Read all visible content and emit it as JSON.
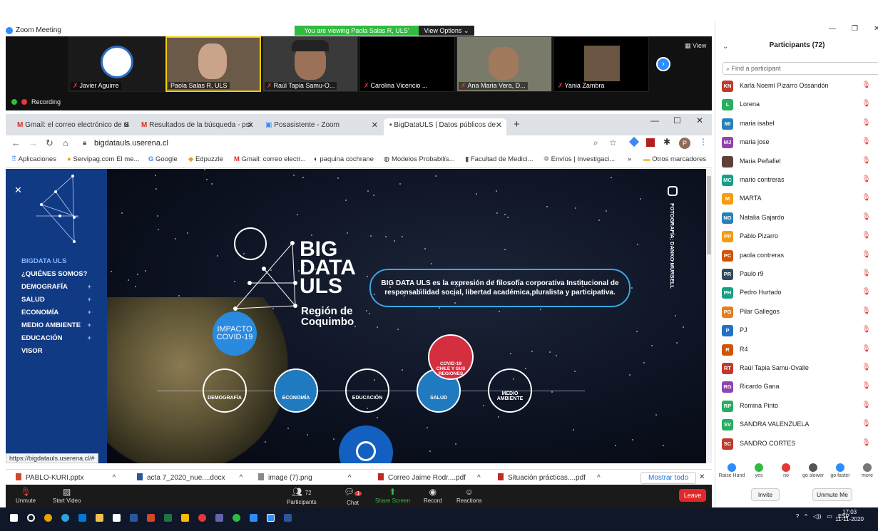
{
  "zoom": {
    "window_title": "Zoom Meeting",
    "viewing_banner": "You are viewing Paola Salas R, ULS' screen",
    "view_options": "View Options ⌄",
    "view_label": "View",
    "recording": "Recording",
    "tiles": [
      {
        "name": "Javier Aguirre"
      },
      {
        "name": "Paola Salas R, ULS"
      },
      {
        "name": "Raúl Tapia Samu-O..."
      },
      {
        "name": "Carolina Vicencio ..."
      },
      {
        "name": "Ana Maria Vera, D..."
      },
      {
        "name": "Yania Zambra"
      }
    ]
  },
  "browser": {
    "tabs": [
      {
        "label": "Gmail: el correo electrónico de G"
      },
      {
        "label": "Resultados de la búsqueda - psi"
      },
      {
        "label": "Posasistente - Zoom"
      },
      {
        "label": "BigDataULS | Datos públicos de"
      }
    ],
    "url": "bigdatauls.userena.cl",
    "bookmarks": [
      "Aplicaciones",
      "Servipag.com El me...",
      "Google",
      "Edpuzzle",
      "Gmail: correo electr...",
      "paquina cochrane",
      "Modelos Probabilís...",
      "Facultad de Medici...",
      "Envíos | Investigaci...",
      "»",
      "Otros marcadores"
    ],
    "status_url": "https://bigdatauls.userena.cl/#",
    "downloads": [
      "PABLO-KURI.pptx",
      "acta 7_2020_nue....docx",
      "image (7).png",
      "Correo Jaime Rodr....pdf",
      "Situación prácticas....pdf"
    ],
    "show_all": "Mostrar todo"
  },
  "site": {
    "menu": [
      {
        "label": "BIGDATA ULS",
        "plus": ""
      },
      {
        "label": "¿QUIÉNES SOMOS?",
        "plus": ""
      },
      {
        "label": "DEMOGRAFÍA",
        "plus": "+"
      },
      {
        "label": "SALUD",
        "plus": "+"
      },
      {
        "label": "ECONOMÍA",
        "plus": "+"
      },
      {
        "label": "MEDIO AMBIENTE",
        "plus": "+"
      },
      {
        "label": "EDUCACIÓN",
        "plus": "+"
      },
      {
        "label": "VISOR",
        "plus": ""
      }
    ],
    "big_line1": "BIG",
    "big_line2": "DATA",
    "big_line3": "ULS",
    "region1": "Región de",
    "region2": "Coquimbo",
    "description": "BIG DATA ULS es la expresión de filosofía corporativa Institucional de responsabilidad social, libertad académica,pluralista y participativa.",
    "impacto1": "IMPACTO",
    "impacto2": "COVID-19",
    "covid_badge1": "COVID-19",
    "covid_badge2": "CHILE Y SUS",
    "covid_badge3": "REGIONES",
    "circles": [
      "DEMOGRAFÍA",
      "ECONOMÍA",
      "EDUCACIÓN",
      "SALUD",
      "MEDIO AMBIENTE"
    ],
    "photo_credit": "FOTOGRAFÍA: DANKO MURSELL"
  },
  "toolbar": {
    "unmute": "Unmute",
    "start_video": "Start Video",
    "participants_count": "72",
    "participants": "Participants",
    "chat": "Chat",
    "chat_badge": "1",
    "share_screen": "Share Screen",
    "record": "Record",
    "reactions": "Reactions",
    "leave": "Leave"
  },
  "panel": {
    "title": "Participants (72)",
    "find_placeholder": "Find a participant",
    "participants": [
      {
        "initials": "KN",
        "name": "Karla Noemí Pizarro Ossandón",
        "color": "#c0392b"
      },
      {
        "initials": "L",
        "name": "Lorena",
        "color": "#27ae60"
      },
      {
        "initials": "MI",
        "name": "maria isabel",
        "color": "#2980b9"
      },
      {
        "initials": "MJ",
        "name": "maria jose",
        "color": "#8e44ad"
      },
      {
        "initials": "",
        "name": "Maria Peñafiel",
        "color": "#5d4037"
      },
      {
        "initials": "MC",
        "name": "mario contreras",
        "color": "#16a085"
      },
      {
        "initials": "M",
        "name": "MARTA",
        "color": "#f39c12"
      },
      {
        "initials": "NG",
        "name": "Natalia Gajardo",
        "color": "#2980b9"
      },
      {
        "initials": "PP",
        "name": "Pablo Pizarro",
        "color": "#f39c12"
      },
      {
        "initials": "PC",
        "name": "paola contreras",
        "color": "#d35400"
      },
      {
        "initials": "PR",
        "name": "Paulo r9",
        "color": "#34495e"
      },
      {
        "initials": "PH",
        "name": "Pedro Hurtado",
        "color": "#16a085"
      },
      {
        "initials": "PG",
        "name": "Pilar Gallegos",
        "color": "#e67e22"
      },
      {
        "initials": "P",
        "name": "PJ",
        "color": "#2471c8"
      },
      {
        "initials": "R",
        "name": "R4",
        "color": "#d35400"
      },
      {
        "initials": "RT",
        "name": "Raúl Tapia Samu-Ovalle",
        "color": "#c0392b"
      },
      {
        "initials": "RG",
        "name": "Ricardo Gana",
        "color": "#8e44ad"
      },
      {
        "initials": "RP",
        "name": "Romina Pinto",
        "color": "#27ae60"
      },
      {
        "initials": "SV",
        "name": "SANDRA VALENZUELA",
        "color": "#27ae60"
      },
      {
        "initials": "SC",
        "name": "SANDRO CORTES",
        "color": "#c0392b"
      }
    ],
    "reactions": [
      {
        "label": "Raise Hand",
        "color": "#2d8cff"
      },
      {
        "label": "yes",
        "color": "#2fbc3f"
      },
      {
        "label": "no",
        "color": "#e53935"
      },
      {
        "label": "go slower",
        "color": "#555"
      },
      {
        "label": "go faster",
        "color": "#2d8cff"
      },
      {
        "label": "more",
        "color": "#777"
      }
    ],
    "invite": "Invite",
    "unmute_me": "Unmute Me"
  },
  "taskbar": {
    "lang": "ESP",
    "time": "17:03",
    "date": "11-11-2020"
  }
}
